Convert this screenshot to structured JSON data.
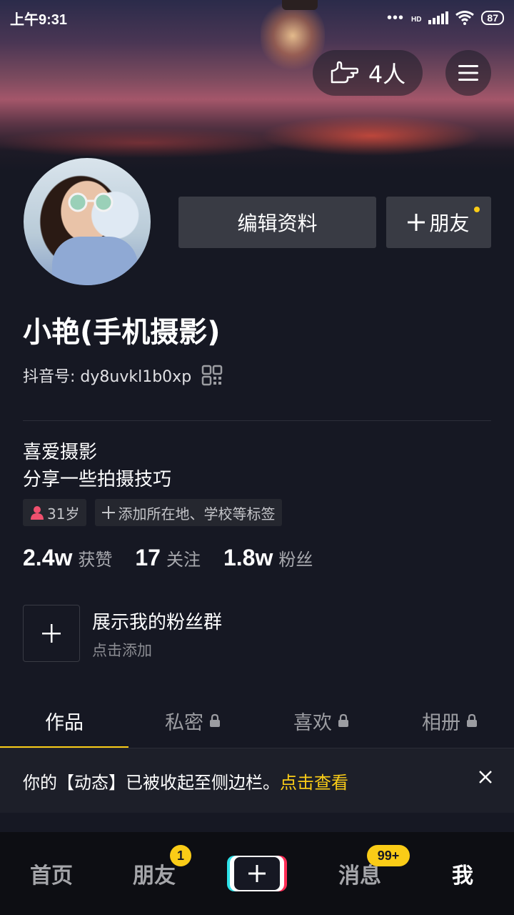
{
  "status_bar": {
    "time": "上午9:31",
    "network": "HD",
    "battery": "87"
  },
  "header": {
    "visitors": "4人"
  },
  "profile": {
    "edit_label": "编辑资料",
    "add_friend_label": "朋友",
    "name": "小艳(手机摄影)",
    "douyin_id_label": "抖音号:",
    "douyin_id": "dy8uvkl1b0xp",
    "bio_line1": "喜爱摄影",
    "bio_line2": "分享一些拍摄技巧",
    "tags": {
      "age": "31岁",
      "add_location": "添加所在地、学校等标签"
    },
    "stats": {
      "likes_value": "2.4w",
      "likes_label": "获赞",
      "following_value": "17",
      "following_label": "关注",
      "followers_value": "1.8w",
      "followers_label": "粉丝"
    },
    "fan_group": {
      "title": "展示我的粉丝群",
      "subtitle": "点击添加"
    }
  },
  "tabs": [
    {
      "label": "作品"
    },
    {
      "label": "私密"
    },
    {
      "label": "喜欢"
    },
    {
      "label": "相册"
    }
  ],
  "notice": {
    "text": "你的【动态】已被收起至侧边栏。",
    "link": "点击查看"
  },
  "bottom_nav": {
    "home": "首页",
    "friends": "朋友",
    "friends_badge": "1",
    "messages": "消息",
    "messages_badge": "99+",
    "me": "我"
  },
  "colors": {
    "background": "#161823",
    "accent": "#facc17",
    "button": "#393b44"
  }
}
